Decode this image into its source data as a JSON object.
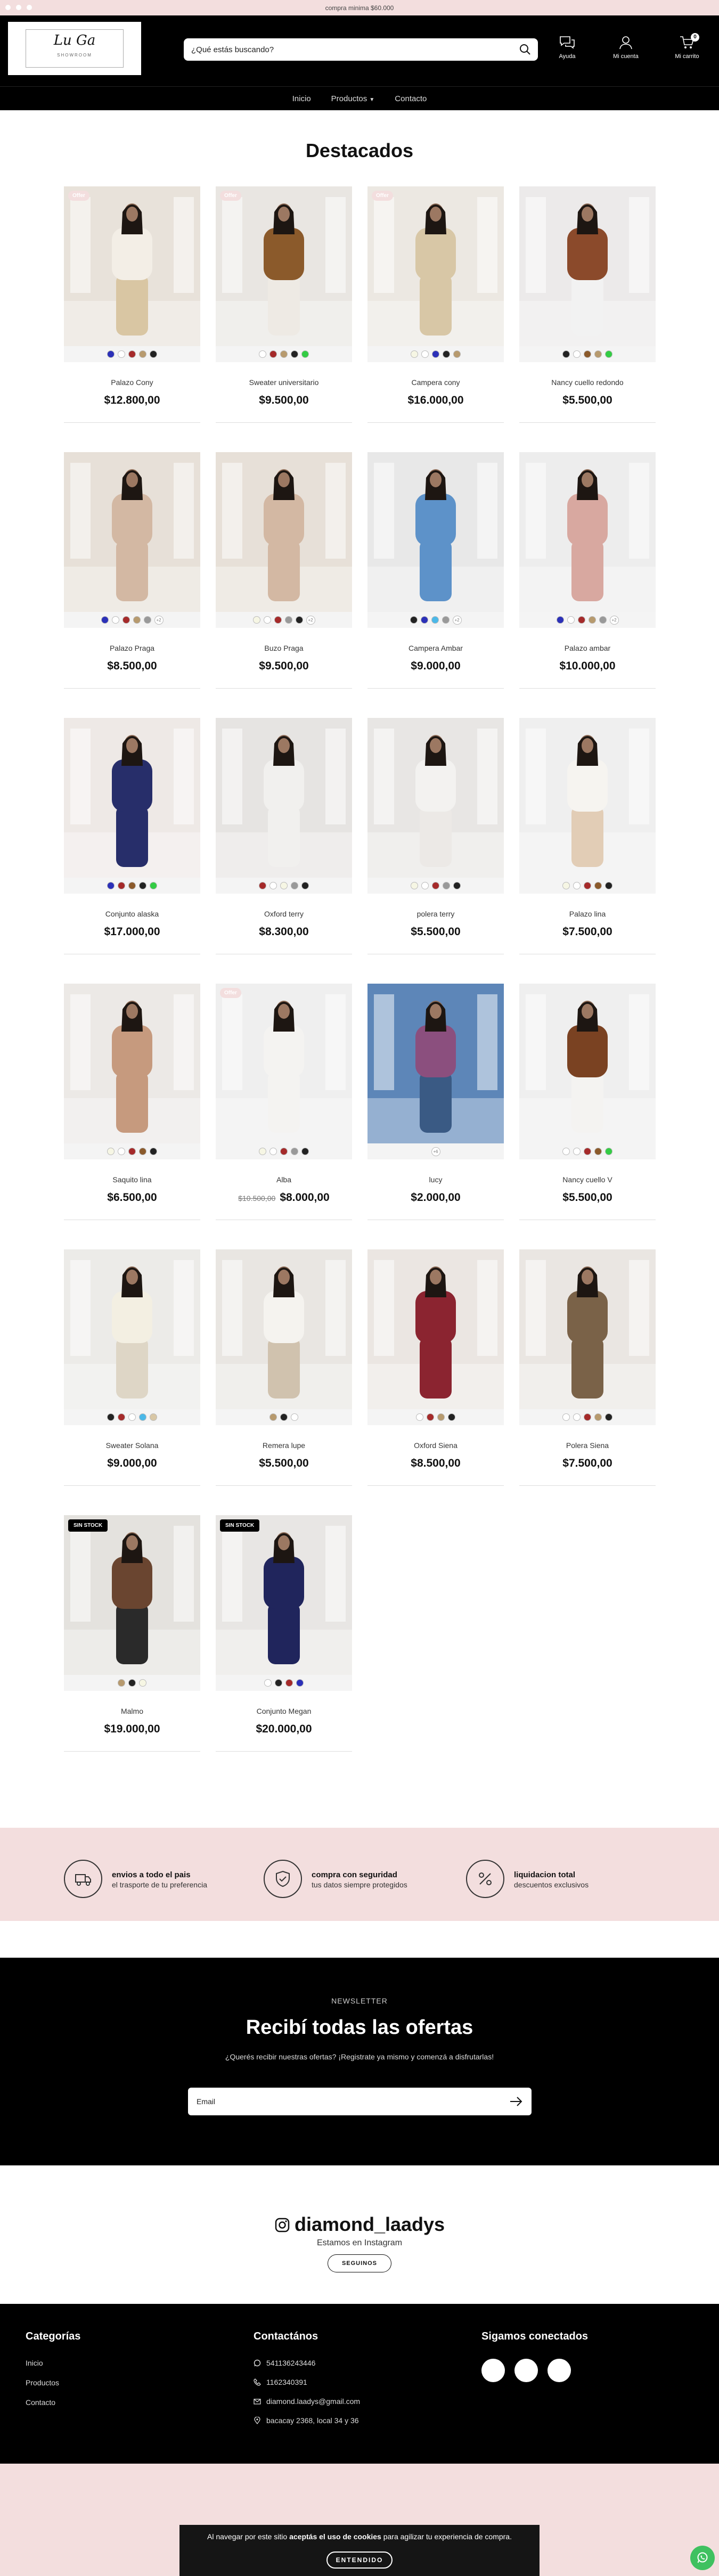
{
  "topbar": {
    "message": "compra minima $60.000"
  },
  "header": {
    "logo_text": "Lu Ga",
    "logo_subtext": "SHOWROOM",
    "search_placeholder": "¿Qué estás buscando?",
    "icons": [
      {
        "name": "help-icon",
        "label": "Ayuda"
      },
      {
        "name": "account-icon",
        "label": "Mi cuenta"
      },
      {
        "name": "cart-icon",
        "label": "Mi carrito",
        "count": "0"
      }
    ]
  },
  "nav": {
    "items": [
      "Inicio",
      "Productos",
      "Contacto"
    ]
  },
  "featured": {
    "title": "Destacados",
    "products": [
      {
        "name": "Palazo Cony",
        "price": "$12.800,00",
        "tag": "Offer",
        "swatches": [
          "#2b30b8",
          "#ffffff",
          "#a52a2a",
          "#b79a6e",
          "#222222"
        ],
        "more": "",
        "img": {
          "bg": "#e8e2da",
          "top": "#f3eee6",
          "bottom": "#d9c6a3"
        }
      },
      {
        "name": "Sweater universitario",
        "price": "$9.500,00",
        "tag": "Offer",
        "swatches": [
          "#ffffff",
          "#a52a2a",
          "#b79a6e",
          "#222222",
          "#33cc44"
        ],
        "more": "",
        "img": {
          "bg": "#e9e6e2",
          "top": "#8b5a2b",
          "bottom": "#eeeae4"
        }
      },
      {
        "name": "Campera cony",
        "price": "$16.000,00",
        "tag": "Offer",
        "swatches": [
          "#f6f6e4",
          "#ffffff",
          "#2b30b8",
          "#222222",
          "#b79a6e"
        ],
        "more": "",
        "img": {
          "bg": "#ece8e2",
          "top": "#d8c7a6",
          "bottom": "#d8c7a6"
        }
      },
      {
        "name": "Nancy cuello redondo",
        "price": "$5.500,00",
        "tag": "",
        "swatches": [
          "#222222",
          "#ffffff",
          "#8b5a2b",
          "#b79a6e",
          "#33cc44"
        ],
        "more": "",
        "img": {
          "bg": "#eceaea",
          "top": "#8b4a2b",
          "bottom": "#f2f2f2"
        }
      },
      {
        "name": "Palazo Praga",
        "price": "$8.500,00",
        "tag": "",
        "swatches": [
          "#2b30b8",
          "#ffffff",
          "#a52a2a",
          "#b79a6e",
          "#999999"
        ],
        "more": "+2",
        "img": {
          "bg": "#e7e0d8",
          "top": "#d3b8a3",
          "bottom": "#d3b8a3"
        }
      },
      {
        "name": "Buzo Praga",
        "price": "$9.500,00",
        "tag": "",
        "swatches": [
          "#f6f6e4",
          "#ffffff",
          "#a52a2a",
          "#999999",
          "#222222"
        ],
        "more": "+2",
        "img": {
          "bg": "#e7e0d8",
          "top": "#d3b8a3",
          "bottom": "#d3b8a3"
        }
      },
      {
        "name": "Campera Ambar",
        "price": "$9.000,00",
        "tag": "",
        "swatches": [
          "#222222",
          "#2b30b8",
          "#4bb8e8",
          "#999999"
        ],
        "more": "+2",
        "img": {
          "bg": "#e8e8e8",
          "top": "#5d92c9",
          "bottom": "#5d92c9"
        }
      },
      {
        "name": "Palazo ambar",
        "price": "$10.000,00",
        "tag": "",
        "swatches": [
          "#2b30b8",
          "#ffffff",
          "#a52a2a",
          "#b79a6e",
          "#999999"
        ],
        "more": "+2",
        "img": {
          "bg": "#ededed",
          "top": "#d8a8a0",
          "bottom": "#d8a8a0"
        }
      },
      {
        "name": "Conjunto alaska",
        "price": "$17.000,00",
        "tag": "",
        "swatches": [
          "#2b30b8",
          "#a52a2a",
          "#8b5a2b",
          "#222222",
          "#33cc44"
        ],
        "more": "",
        "img": {
          "bg": "#eee9e6",
          "top": "#272e6a",
          "bottom": "#272e6a"
        }
      },
      {
        "name": "Oxford terry",
        "price": "$8.300,00",
        "tag": "",
        "swatches": [
          "#a52a2a",
          "#ffffff",
          "#f6f6e4",
          "#999999",
          "#222222"
        ],
        "more": "",
        "img": {
          "bg": "#e6e4e2",
          "top": "#f1f0ee",
          "bottom": "#f1f0ee"
        }
      },
      {
        "name": "polera terry",
        "price": "$5.500,00",
        "tag": "",
        "swatches": [
          "#f6f6e4",
          "#ffffff",
          "#a52a2a",
          "#999999",
          "#222222"
        ],
        "more": "",
        "img": {
          "bg": "#e8e6e4",
          "top": "#f3f2f0",
          "bottom": "#ece9e6"
        }
      },
      {
        "name": "Palazo lina",
        "price": "$7.500,00",
        "tag": "",
        "swatches": [
          "#f6f6e4",
          "#ffffff",
          "#a52a2a",
          "#8b5a2b",
          "#222222"
        ],
        "more": "",
        "img": {
          "bg": "#efefef",
          "top": "#f6f4f0",
          "bottom": "#e2cdb6"
        }
      },
      {
        "name": "Saquito lina",
        "price": "$6.500,00",
        "tag": "",
        "swatches": [
          "#f6f6e4",
          "#ffffff",
          "#a52a2a",
          "#8b5a2b",
          "#222222"
        ],
        "more": "",
        "img": {
          "bg": "#ece9e6",
          "top": "#c69a7e",
          "bottom": "#c69a7e"
        }
      },
      {
        "name": "Alba",
        "price": "$8.000,00",
        "old_price": "$10.500,00",
        "tag": "Offer",
        "swatches": [
          "#f6f6e4",
          "#ffffff",
          "#a52a2a",
          "#999999",
          "#222222"
        ],
        "more": "",
        "img": {
          "bg": "#efefef",
          "top": "#f4f3f1",
          "bottom": "#f4f3f1"
        }
      },
      {
        "name": "lucy",
        "price": "$2.000,00",
        "tag": "",
        "swatches": [],
        "more": "+6",
        "img": {
          "bg": "#5d86b8",
          "top": "#8b4f7e",
          "bottom": "#3a5a84"
        }
      },
      {
        "name": "Nancy cuello V",
        "price": "$5.500,00",
        "tag": "",
        "swatches": [
          "#ffffff",
          "#ffffff",
          "#a52a2a",
          "#8b5a2b",
          "#33cc44"
        ],
        "more": "",
        "img": {
          "bg": "#efefef",
          "top": "#7a4222",
          "bottom": "#f4f3f1"
        }
      },
      {
        "name": "Sweater Solana",
        "price": "$9.000,00",
        "tag": "",
        "swatches": [
          "#222222",
          "#a52a2a",
          "#ffffff",
          "#4bb8e8",
          "#d8c7a6"
        ],
        "more": "",
        "img": {
          "bg": "#ecebe8",
          "top": "#f3efe2",
          "bottom": "#ded6c6"
        }
      },
      {
        "name": "Remera lupe",
        "price": "$5.500,00",
        "tag": "",
        "swatches": [
          "#b79a6e",
          "#222222",
          "#ffffff"
        ],
        "more": "",
        "img": {
          "bg": "#e9e6e2",
          "top": "#f5f3ef",
          "bottom": "#d0c2ae"
        }
      },
      {
        "name": "Oxford Siena",
        "price": "$8.500,00",
        "tag": "",
        "swatches": [
          "#ffffff",
          "#a52a2a",
          "#b79a6e",
          "#222222"
        ],
        "more": "",
        "img": {
          "bg": "#ebe6e2",
          "top": "#8b2430",
          "bottom": "#8b2430"
        }
      },
      {
        "name": "Polera Siena",
        "price": "$7.500,00",
        "tag": "",
        "swatches": [
          "#ffffff",
          "#ffffff",
          "#a52a2a",
          "#b79a6e",
          "#222222"
        ],
        "more": "",
        "img": {
          "bg": "#eae6e2",
          "top": "#7a6248",
          "bottom": "#7a6248"
        }
      },
      {
        "name": "Malmo",
        "price": "$19.000,00",
        "tag": "SIN STOCK",
        "swatches": [
          "#b79a6e",
          "#222222",
          "#f6f6e4"
        ],
        "more": "",
        "img": {
          "bg": "#e4e2de",
          "top": "#6a4530",
          "bottom": "#2a2a2a"
        }
      },
      {
        "name": "Conjunto Megan",
        "price": "$20.000,00",
        "tag": "SIN STOCK",
        "swatches": [
          "#ffffff",
          "#222222",
          "#a52a2a",
          "#2b30b8"
        ],
        "more": "",
        "img": {
          "bg": "#e8e6e4",
          "top": "#20255c",
          "bottom": "#20255c"
        }
      }
    ]
  },
  "benefits": [
    {
      "icon": "truck-icon",
      "title": "envios a todo el pais",
      "subtitle": "el trasporte de tu preferencia"
    },
    {
      "icon": "shield-check-icon",
      "title": "compra con seguridad",
      "subtitle": "tus datos siempre protegidos"
    },
    {
      "icon": "percent-icon",
      "title": "liquidacion total",
      "subtitle": "descuentos exclusivos"
    }
  ],
  "newsletter": {
    "eyebrow": "NEWSLETTER",
    "title": "Recibí todas las ofertas",
    "text": "¿Querés recibir nuestras ofertas? ¡Registrate ya mismo y comenzá a disfrutarlas!",
    "placeholder": "Email"
  },
  "instagram": {
    "handle": "diamond_laadys",
    "subtitle": "Estamos en Instagram",
    "button": "SEGUINOS"
  },
  "footer": {
    "categories_title": "Categorías",
    "categories": [
      "Inicio",
      "Productos",
      "Contacto"
    ],
    "contact_title": "Contactános",
    "contacts": [
      {
        "icon": "whatsapp-icon",
        "text": "541136243446"
      },
      {
        "icon": "phone-icon",
        "text": "1162340391"
      },
      {
        "icon": "mail-icon",
        "text": "diamond.laadys@gmail.com"
      },
      {
        "icon": "location-icon",
        "text": "bacacay 2368, local 34 y 36"
      }
    ],
    "social_title": "Sigamos conectados"
  },
  "cookie": {
    "text_before": "Al navegar por este sitio ",
    "text_bold": "aceptás el uso de cookies",
    "text_after": " para agilizar tu experiencia de compra.",
    "button": "ENTENDIDO"
  },
  "colors": {
    "accent_pink": "#f3dede",
    "black": "#000000",
    "whatsapp": "#3fc160"
  }
}
